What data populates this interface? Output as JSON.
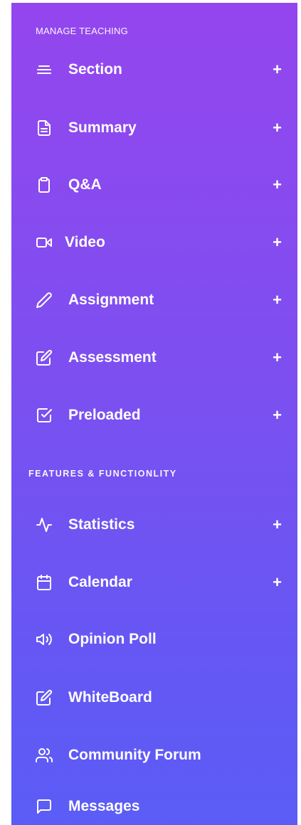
{
  "sidebar": {
    "sections": [
      {
        "title": "MANAGE TEACHING",
        "items": [
          {
            "label": "Section",
            "plus": "+",
            "icon": "menu-lines-icon"
          },
          {
            "label": "Summary",
            "plus": "+",
            "icon": "document-icon"
          },
          {
            "label": "Q&A",
            "plus": "+",
            "icon": "clipboard-icon"
          },
          {
            "label": "Video",
            "plus": "+",
            "icon": "video-camera-icon"
          },
          {
            "label": "Assignment",
            "plus": "+",
            "icon": "pencil-icon"
          },
          {
            "label": "Assessment",
            "plus": "+",
            "icon": "edit-square-icon"
          },
          {
            "label": "Preloaded",
            "plus": "+",
            "icon": "checkbox-icon"
          }
        ]
      },
      {
        "title": "FEATURES & FUNCTIONLITY",
        "items": [
          {
            "label": "Statistics",
            "plus": "+",
            "icon": "activity-pulse-icon"
          },
          {
            "label": "Calendar",
            "plus": "+",
            "icon": "calendar-icon"
          },
          {
            "label": "Opinion Poll",
            "icon": "speaker-icon"
          },
          {
            "label": "WhiteBoard",
            "icon": "edit-square-icon"
          },
          {
            "label": "Community Forum",
            "icon": "users-icon"
          },
          {
            "label": "Messages",
            "icon": "message-square-icon"
          }
        ]
      }
    ],
    "colors": {
      "gradient_top": "#9446ee",
      "gradient_bottom": "#5b5cf6",
      "text": "#ffffff"
    }
  }
}
